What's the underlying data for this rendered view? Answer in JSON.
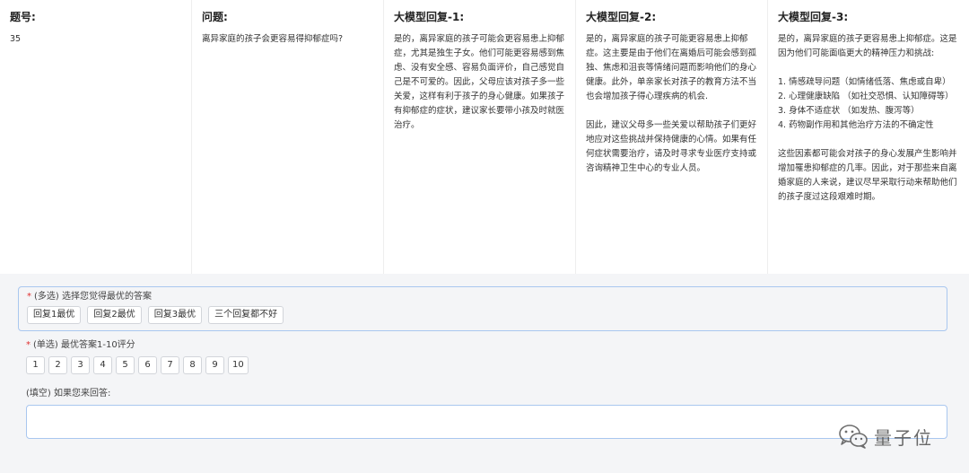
{
  "table": {
    "columns": [
      {
        "header": "题号:",
        "body": "35"
      },
      {
        "header": "问题:",
        "body": "离异家庭的孩子会更容易得抑郁症吗?"
      },
      {
        "header": "大模型回复-1:",
        "body": "是的，离异家庭的孩子可能会更容易患上抑郁症，尤其是独生子女。他们可能更容易感到焦虑、没有安全感、容易负面评价，自己感觉自己是不可爱的。因此，父母应该对孩子多一些关爱，这样有利于孩子的身心健康。如果孩子有抑郁症的症状，建议家长要带小孩及时就医治疗。"
      },
      {
        "header": "大模型回复-2:",
        "body": "是的，离异家庭的孩子可能更容易患上抑郁症。这主要是由于他们在离婚后可能会感到孤独、焦虑和沮丧等情绪问题而影响他们的身心健康。此外，单亲家长对孩子的教育方法不当也会增加孩子得心理疾病的机会.\n\n因此，建议父母多一些关爱以帮助孩子们更好地应对这些挑战并保持健康的心情。如果有任何症状需要治疗，请及时寻求专业医疗支持或咨询精神卫生中心的专业人员。"
      },
      {
        "header": "大模型回复-3:",
        "body": "是的，离异家庭的孩子更容易患上抑郁症。这是因为他们可能面临更大的精神压力和挑战:\n\n1. 情感疏导问题（如情绪低落、焦虑或自卑）\n2. 心理健康缺陷 （如社交恐惧、认知障碍等）\n3. 身体不适症状 （如发热、腹泻等）\n4. 药物副作用和其他治疗方法的不确定性\n\n这些因素都可能会对孩子的身心发展产生影响并增加罹患抑郁症的几率。因此，对于那些来自离婚家庭的人来说，建议尽早采取行动来帮助他们的孩子度过这段艰难时期。"
      }
    ]
  },
  "survey": {
    "required_mark": "*",
    "q1": {
      "label": "(多选) 选择您觉得最优的答案",
      "options": [
        "回复1最优",
        "回复2最优",
        "回复3最优",
        "三个回复都不好"
      ]
    },
    "q2": {
      "label": "(单选) 最优答案1-10评分",
      "options": [
        "1",
        "2",
        "3",
        "4",
        "5",
        "6",
        "7",
        "8",
        "9",
        "10"
      ]
    },
    "q3": {
      "label": "(填空) 如果您来回答:",
      "value": ""
    }
  },
  "watermark": {
    "icon": "wechat-icon",
    "text": "量子位"
  }
}
